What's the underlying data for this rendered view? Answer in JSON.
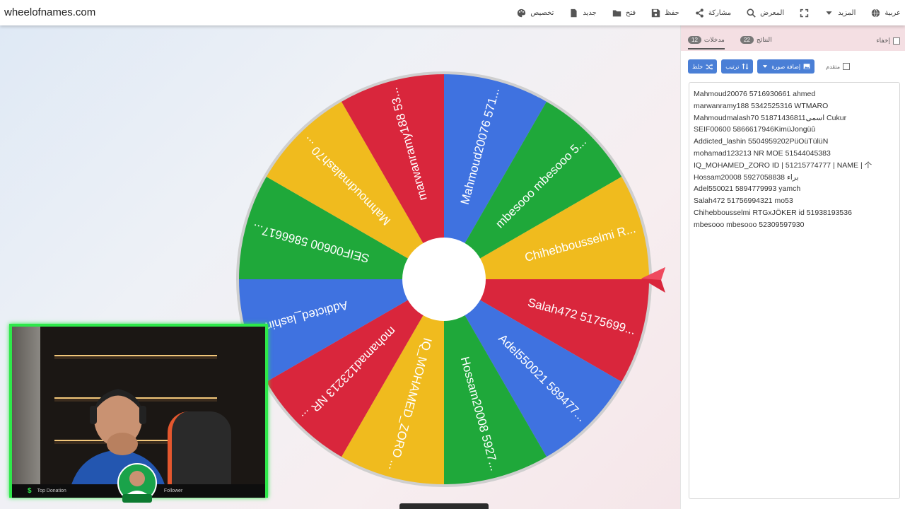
{
  "site": {
    "title": "wheelofnames.com"
  },
  "menu": [
    {
      "label": "عربية",
      "icon": "globe-icon"
    },
    {
      "label": "المزيد",
      "icon": "caret-down-icon"
    },
    {
      "label": "",
      "icon": "fullscreen-icon"
    },
    {
      "label": "المعرض",
      "icon": "search-icon"
    },
    {
      "label": "مشاركة",
      "icon": "share-icon"
    },
    {
      "label": "حفظ",
      "icon": "save-icon"
    },
    {
      "label": "فتح",
      "icon": "folder-icon"
    },
    {
      "label": "جديد",
      "icon": "file-icon"
    },
    {
      "label": "تخصيص",
      "icon": "palette-icon"
    }
  ],
  "panel": {
    "hide_label": "إخفاء",
    "tab_results": {
      "label": "النتائج",
      "count": "22"
    },
    "tab_entries": {
      "label": "مدخلات",
      "count": "12"
    },
    "shuffle_label": "خلط",
    "sort_label": "ترتيب",
    "add_image_label": "إضافة صورة",
    "advanced_label": "متقدم",
    "entries": [
      "Mahmoud20076 5716930661 ahmed",
      "marwanramy188 5342525316 WTMARO",
      "Mahmoudmalash70 51871436811اسمی Cukur",
      "SEIF00600 5866617946KimüJongüû",
      "Addicted_lashin 5504959202PüOüTülüN",
      "mohamad123213 NR MOE 51544045383",
      "IQ_MOHAMED_ZORO ID | 51215774777 | NAME | 个",
      "Hossam20008 5927058838 براء",
      "Adel550021 5894779993 yamch",
      "Salah472 51756994321 mo53",
      "Chihebbousselmi RTGxJÖKER id 51938193536",
      "mbesooo mbesooo 52309597930"
    ]
  },
  "wheel": {
    "colors": {
      "blue": "#3f72e0",
      "green": "#1fa83a",
      "yellow": "#f0bb1e",
      "red": "#d9263c"
    },
    "segments": [
      {
        "label": "Salah472  5175699...",
        "color": "#d9263c"
      },
      {
        "label": "Adel550021 589477...",
        "color": "#3f72e0"
      },
      {
        "label": "Hossam20008  5927...",
        "color": "#1fa83a"
      },
      {
        "label": "IQ_MOHAMED_ZORO ...",
        "color": "#f0bb1e"
      },
      {
        "label": "mohamad123213 NR ...",
        "color": "#d9263c"
      },
      {
        "label": "Addicted_lashin ...",
        "color": "#3f72e0"
      },
      {
        "label": "SEIF00600  5866617...",
        "color": "#1fa83a"
      },
      {
        "label": "Mahmoudmalash70 ...",
        "color": "#f0bb1e"
      },
      {
        "label": "marwanramy188  53...",
        "color": "#d9263c"
      },
      {
        "label": "Mahmoud20076  571...",
        "color": "#3f72e0"
      },
      {
        "label": "mbesooo mbesooo 5...",
        "color": "#1fa83a"
      },
      {
        "label": "Chihebbousselmi R...",
        "color": "#f0bb1e"
      }
    ],
    "pointer_color": "#d9263c"
  },
  "stream": {
    "bar_text_left": "Top Donation",
    "bar_text_right": "Follower"
  }
}
